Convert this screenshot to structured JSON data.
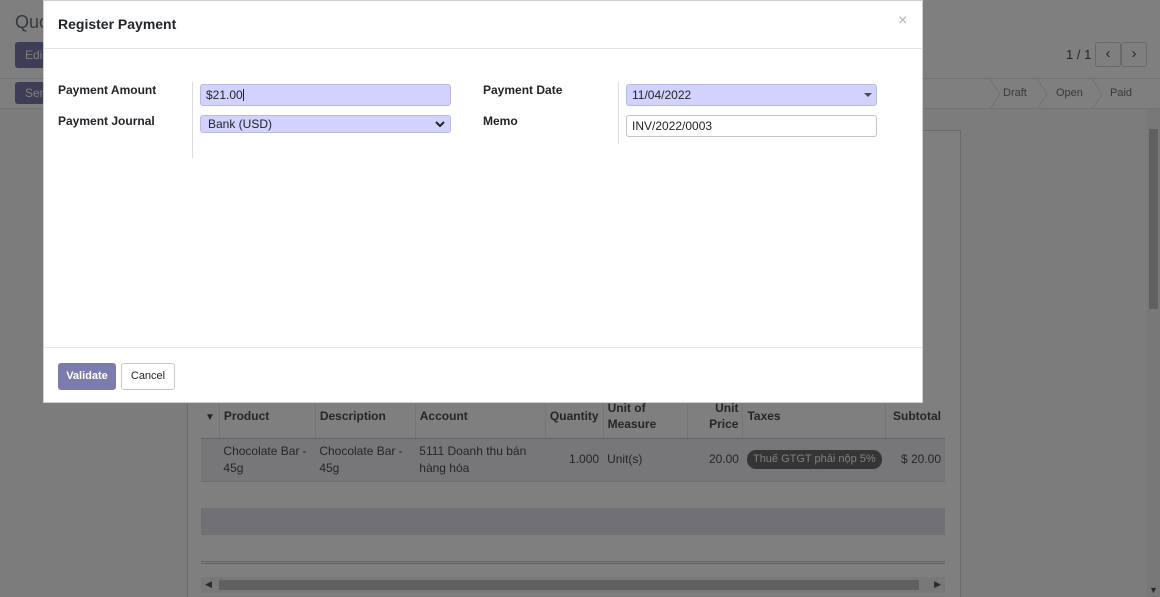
{
  "background": {
    "breadcrumb": "Quo",
    "edit_label": "Edi",
    "send_label": "Sen",
    "pager": {
      "value": "1 / 1",
      "prev_icon": "chevron-left-icon",
      "next_icon": "chevron-right-icon"
    },
    "statusbar": [
      "Draft",
      "Open",
      "Paid"
    ],
    "table": {
      "headers": {
        "handle_icon": "sort-caret-icon",
        "product": "Product",
        "description": "Description",
        "account": "Account",
        "quantity": "Quantity",
        "uom_line1": "Unit of",
        "uom_line2": "Measure",
        "price_line1": "Unit",
        "price_line2": "Price",
        "taxes": "Taxes",
        "subtotal": "Subtotal"
      },
      "row": {
        "product_1": "Chocolate Bar -",
        "product_2": "45g",
        "description_1": "Chocolate Bar -",
        "description_2": "45g",
        "account_1": "5111 Doanh thu bán",
        "account_2": "hàng hóa",
        "quantity": "1.000",
        "uom": "Unit(s)",
        "unit_price": "20.00",
        "tax": "Thuế GTGT phải nộp 5%",
        "subtotal": "$ 20.00"
      }
    }
  },
  "modal": {
    "title": "Register Payment",
    "close_icon": "close-icon",
    "fields": {
      "amount_label": "Payment Amount",
      "amount_value": "$21.00",
      "journal_label": "Payment Journal",
      "journal_value": "Bank (USD)",
      "date_label": "Payment Date",
      "date_value": "11/04/2022",
      "memo_label": "Memo",
      "memo_value": "INV/2022/0003"
    },
    "footer": {
      "validate_label": "Validate",
      "cancel_label": "Cancel"
    }
  },
  "colors": {
    "primary": "#7c7bad",
    "field_highlight": "#d2d2ff",
    "backdrop": "rgba(0,0,0,0.5)"
  }
}
